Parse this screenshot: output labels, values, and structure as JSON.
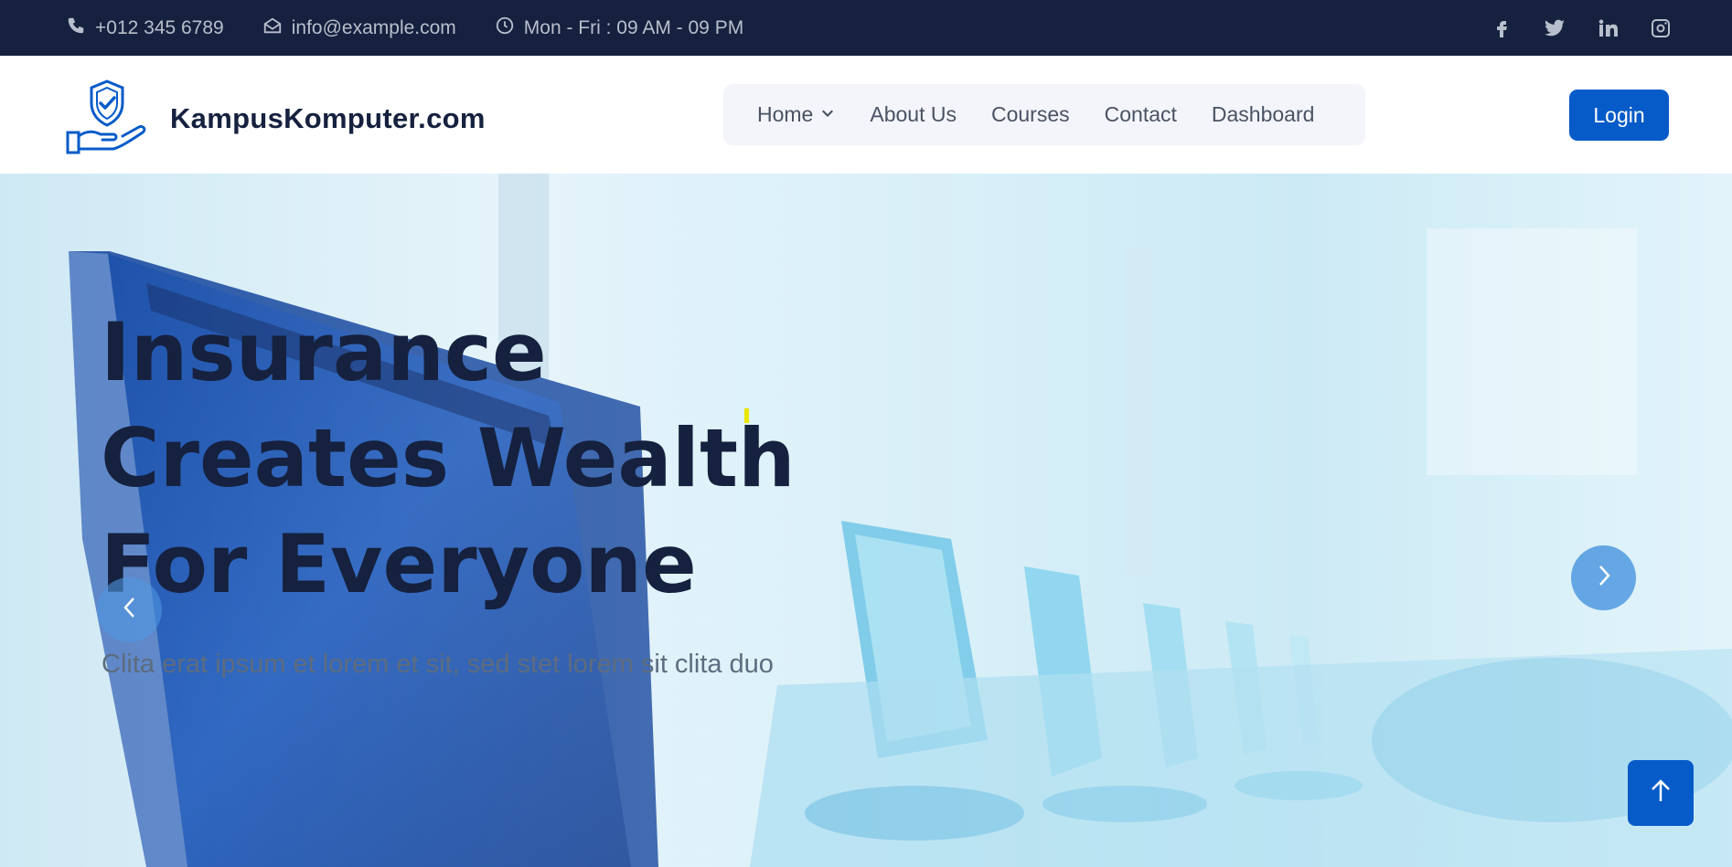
{
  "topbar": {
    "phone": "+012 345 6789",
    "email": "info@example.com",
    "hours": "Mon - Fri : 09 AM - 09 PM",
    "social": [
      "facebook-icon",
      "twitter-icon",
      "linkedin-icon",
      "instagram-icon"
    ]
  },
  "brand": {
    "name": "KampusKomputer.com",
    "logo_icon": "shield-hand-icon"
  },
  "nav": {
    "items": [
      {
        "label": "Home",
        "has_dropdown": true
      },
      {
        "label": "About Us"
      },
      {
        "label": "Courses"
      },
      {
        "label": "Contact"
      },
      {
        "label": "Dashboard"
      }
    ]
  },
  "login": {
    "label": "Login"
  },
  "hero": {
    "title_line1": "Insurance",
    "title_line2": "Creates Wealth",
    "title_line3": "For Everyone",
    "subtitle": "Clita erat ipsum et lorem et sit, sed stet lorem sit clita duo"
  },
  "colors": {
    "topbar_bg": "#15213e",
    "accent": "#065bc8",
    "title": "#15213e",
    "nav_bg": "#f3f5fa"
  }
}
